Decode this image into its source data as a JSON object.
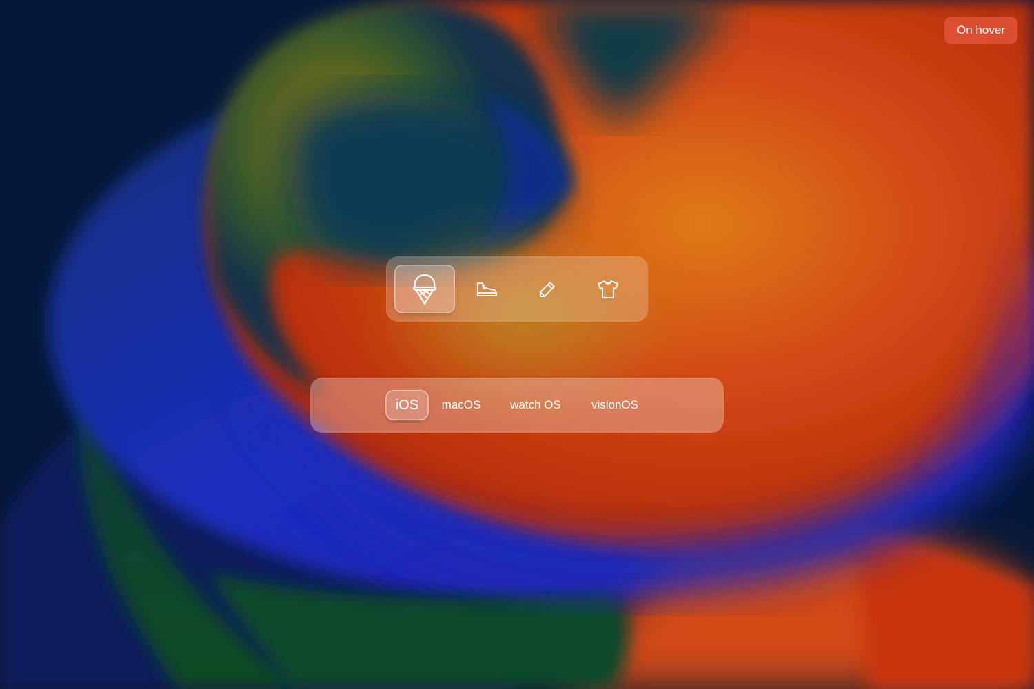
{
  "hover_chip": {
    "label": "On hover"
  },
  "icon_segment": {
    "selected": "ice-cream",
    "items": [
      {
        "icon": "ice-cream-icon",
        "active": true
      },
      {
        "icon": "sneaker-icon",
        "active": false
      },
      {
        "icon": "pencil-icon",
        "active": false
      },
      {
        "icon": "t-shirt-icon",
        "active": false
      }
    ]
  },
  "os_segment": {
    "selected": "iOS",
    "items": [
      {
        "label": "iOS",
        "active": true
      },
      {
        "label": "macOS",
        "active": false
      },
      {
        "label": "watch OS",
        "active": false
      },
      {
        "label": "visionOS",
        "active": false
      }
    ]
  },
  "colors": {
    "background_navy": "#061838",
    "wallpaper_orange": "#e85a10",
    "wallpaper_red": "#c8300a",
    "wallpaper_blue": "#1a2ab8",
    "wallpaper_green": "#0e4a2e",
    "chip": "#d9553d",
    "icon_stroke": "#ffffff"
  }
}
